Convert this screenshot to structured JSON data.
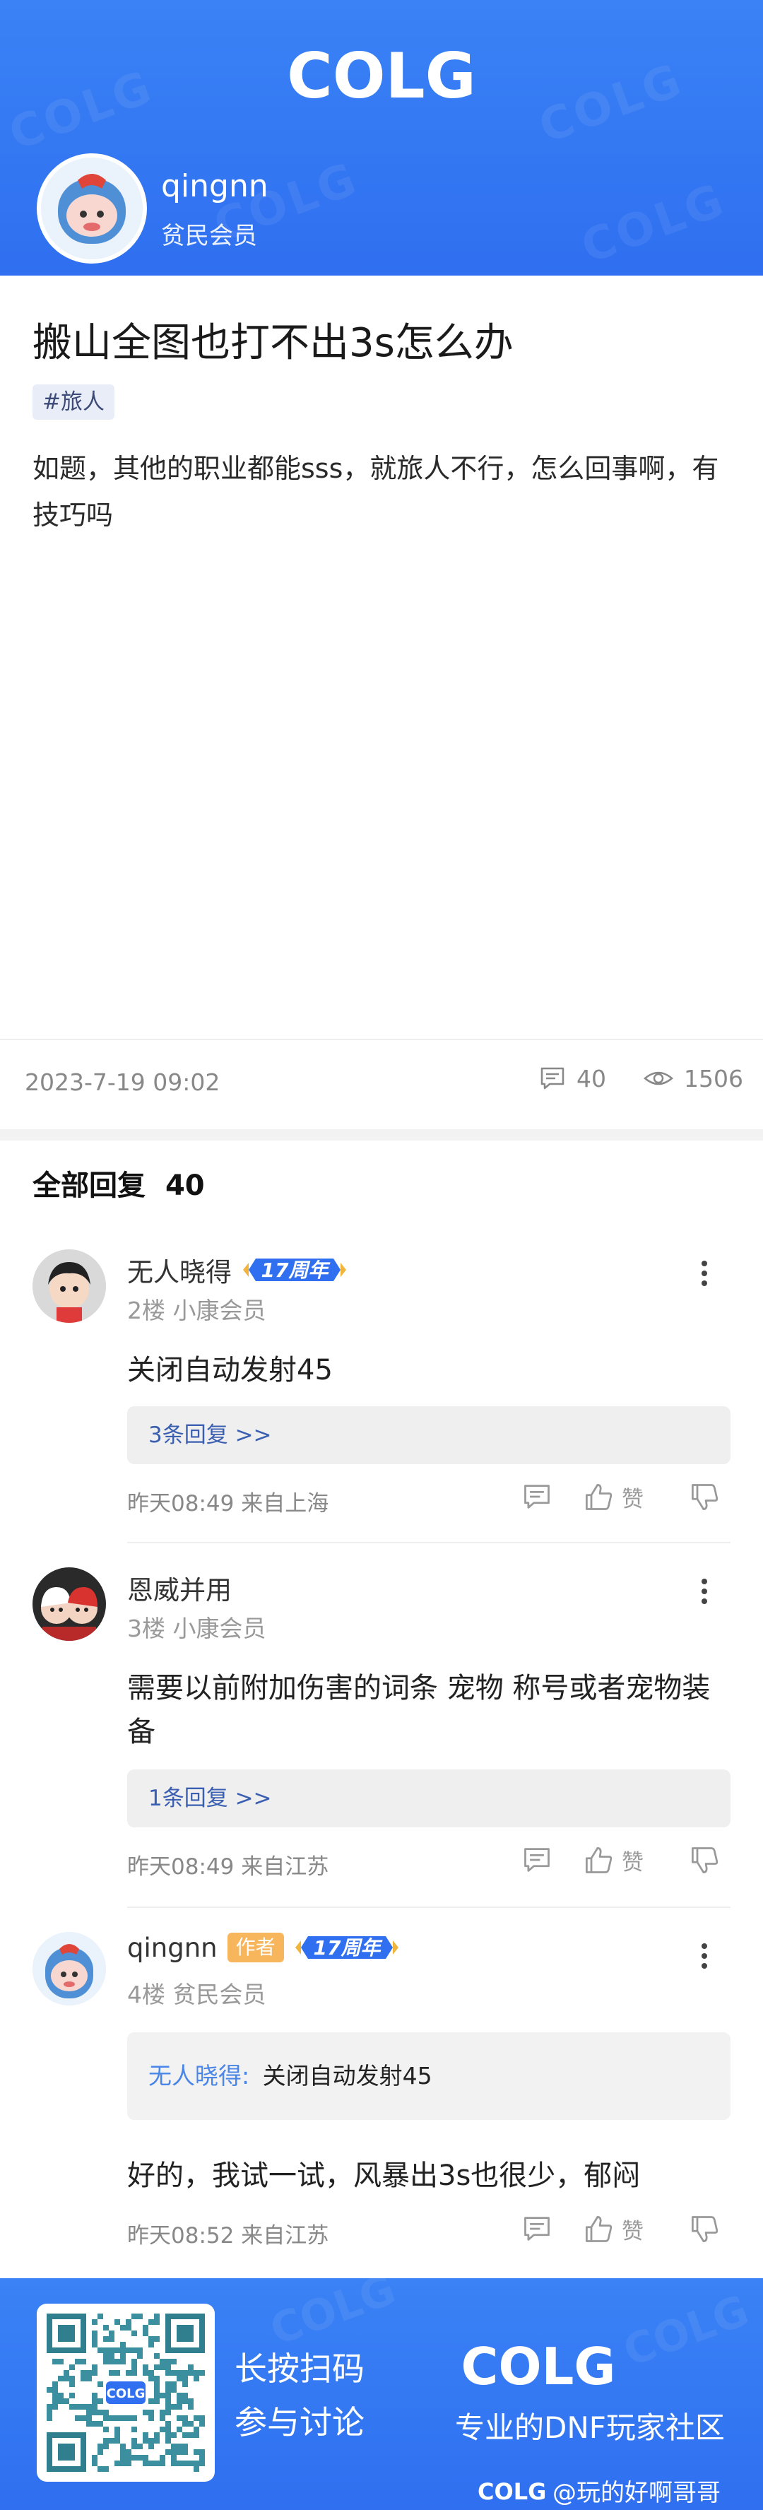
{
  "header": {
    "logo_text": "COLG",
    "user": {
      "name": "qingnn",
      "level": "贫民会员"
    }
  },
  "post": {
    "title": "搬山全图也打不出3s怎么办",
    "tag": "#旅人",
    "body": "如题，其他的职业都能sss，就旅人不行，怎么回事啊，有技巧吗",
    "date": "2023-7-19 09:02",
    "comment_count": "40",
    "view_count": "1506"
  },
  "replies_header": {
    "label": "全部回复",
    "count": "40"
  },
  "replies": [
    {
      "name": "无人晓得",
      "anniversary_badge": "17周年",
      "floor_level": "2楼 小康会员",
      "text": "关闭自动发射45",
      "sub_replies": "3条回复 >>",
      "time_location": "昨天08:49 来自上海",
      "like_label": "赞"
    },
    {
      "name": "恩威并用",
      "floor_level": "3楼 小康会员",
      "text": "需要以前附加伤害的词条 宠物 称号或者宠物装备",
      "sub_replies": "1条回复 >>",
      "time_location": "昨天08:49 来自江苏",
      "like_label": "赞"
    },
    {
      "name": "qingnn",
      "author_badge": "作者",
      "anniversary_badge": "17周年",
      "floor_level": "4楼 贫民会员",
      "quote_name": "无人晓得:",
      "quote_text": "关闭自动发射45",
      "text": "好的，我试一试，风暴出3s也很少，郁闷",
      "time_location": "昨天08:52 来自江苏",
      "like_label": "赞"
    }
  ],
  "footer": {
    "cta_line1": "长按扫码",
    "cta_line2": "参与讨论",
    "logo_text": "COLG",
    "qr_logo_text": "COLG",
    "slogan": "专业的DNF玩家社区",
    "handle_logo": "COLG",
    "handle": "@玩的好啊哥哥"
  },
  "colors": {
    "brand_blue": "#2f6ff0",
    "author_badge": "#f7b55c",
    "quote_name": "#4a86e8"
  }
}
